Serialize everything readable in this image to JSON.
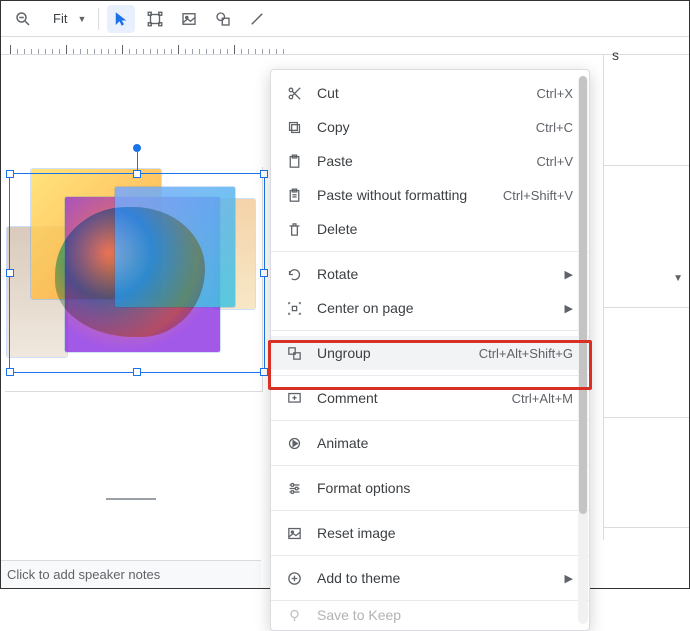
{
  "toolbar": {
    "zoom_label": "Fit",
    "icons": {
      "zoom": "zoom-out-icon",
      "select": "cursor-icon",
      "transform": "transform-icon",
      "image": "image-icon",
      "shape": "shape-icon",
      "line": "line-icon"
    }
  },
  "right_panel": {
    "char": "s"
  },
  "context_menu": {
    "highlighted": "ungroup",
    "items": [
      {
        "icon": "scissors-icon",
        "label": "Cut",
        "shortcut": "Ctrl+X"
      },
      {
        "icon": "copy-icon",
        "label": "Copy",
        "shortcut": "Ctrl+C"
      },
      {
        "icon": "clipboard-icon",
        "label": "Paste",
        "shortcut": "Ctrl+V"
      },
      {
        "icon": "clipboard-plain-icon",
        "label": "Paste without formatting",
        "shortcut": "Ctrl+Shift+V"
      },
      {
        "icon": "trash-icon",
        "label": "Delete",
        "shortcut": ""
      },
      {
        "sep": true
      },
      {
        "icon": "rotate-icon",
        "label": "Rotate",
        "submenu": true
      },
      {
        "icon": "center-icon",
        "label": "Center on page",
        "submenu": true
      },
      {
        "sep": true
      },
      {
        "icon": "ungroup-icon",
        "label": "Ungroup",
        "shortcut": "Ctrl+Alt+Shift+G",
        "hover": true
      },
      {
        "sep": true
      },
      {
        "icon": "comment-icon",
        "label": "Comment",
        "shortcut": "Ctrl+Alt+M"
      },
      {
        "sep": true
      },
      {
        "icon": "animate-icon",
        "label": "Animate",
        "shortcut": ""
      },
      {
        "sep": true
      },
      {
        "icon": "format-icon",
        "label": "Format options",
        "shortcut": ""
      },
      {
        "sep": true
      },
      {
        "icon": "reset-icon",
        "label": "Reset image",
        "shortcut": ""
      },
      {
        "sep": true
      },
      {
        "icon": "theme-icon",
        "label": "Add to theme",
        "submenu": true
      },
      {
        "sep": true
      },
      {
        "icon": "keep-icon",
        "label": "Save to Keep",
        "shortcut": ""
      }
    ]
  },
  "speaker_notes": {
    "placeholder": "Click to add speaker notes"
  }
}
